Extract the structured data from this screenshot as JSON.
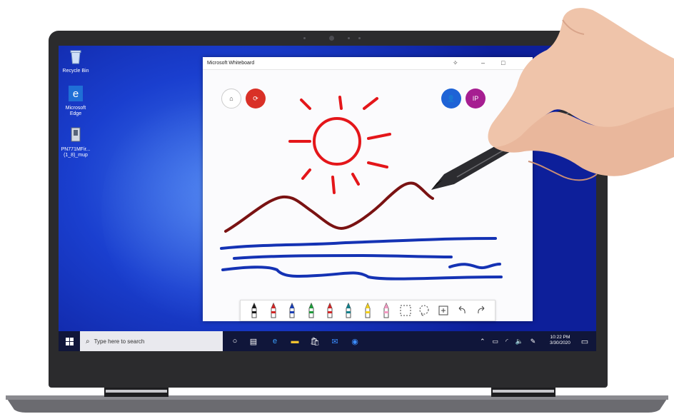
{
  "desktop": {
    "icons": [
      {
        "label": "Recycle Bin",
        "icon": "recycle-bin-icon"
      },
      {
        "label": "Microsoft Edge",
        "icon": "edge-icon"
      },
      {
        "label": "PN771MFir... (1_8)_mup",
        "icon": "file-icon"
      }
    ]
  },
  "whiteboard": {
    "title": "Microsoft Whiteboard",
    "avatar_initials": "IP",
    "colors": {
      "sun": "#e4161a",
      "mountain": "#7a1212",
      "water": "#1432b4",
      "avatar": "#a61e91",
      "invite": "#1e63d6",
      "share": "#d93027"
    },
    "toolbar": [
      "black-pen-icon",
      "red-pen-icon",
      "blue-pen-icon",
      "green-pen-icon",
      "red-pen-icon",
      "teal-pen-icon",
      "yellow-highlighter-icon",
      "pink-eraser-icon",
      "ruler-icon",
      "lasso-icon",
      "add-icon",
      "undo-icon",
      "redo-icon"
    ]
  },
  "taskbar": {
    "search_placeholder": "Type here to search",
    "time": "10:22 PM",
    "date": "3/30/2020"
  }
}
